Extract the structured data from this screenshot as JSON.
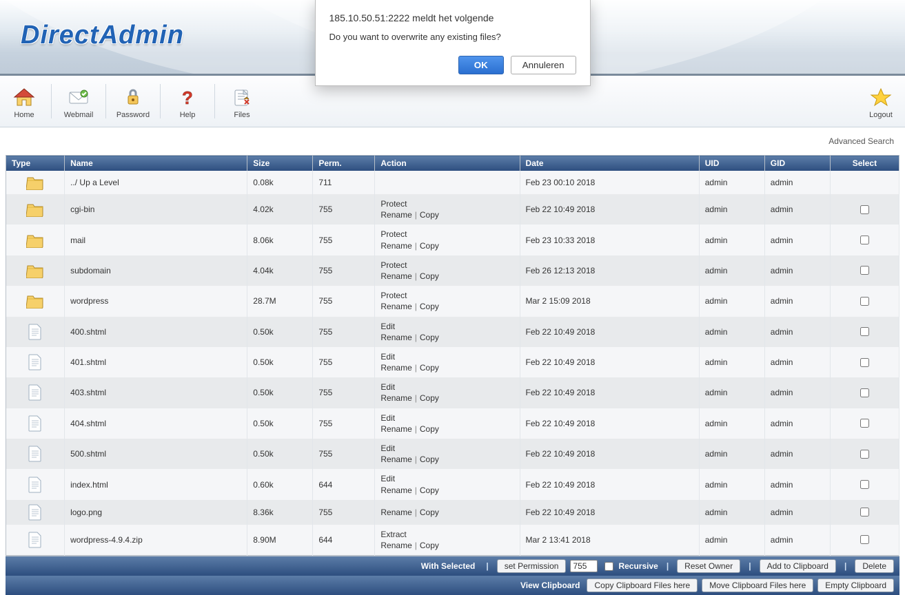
{
  "brand": "DirectAdmin",
  "modal": {
    "title": "185.10.50.51:2222 meldt het volgende",
    "message": "Do you want to overwrite any existing files?",
    "ok": "OK",
    "cancel": "Annuleren"
  },
  "toolbar": {
    "home": "Home",
    "webmail": "Webmail",
    "password": "Password",
    "help": "Help",
    "files": "Files",
    "logout": "Logout"
  },
  "advanced_search": "Advanced Search",
  "columns": {
    "type": "Type",
    "name": "Name",
    "size": "Size",
    "perm": "Perm.",
    "action": "Action",
    "date": "Date",
    "uid": "UID",
    "gid": "GID",
    "select": "Select"
  },
  "action_labels": {
    "protect": "Protect",
    "rename": "Rename",
    "copy": "Copy",
    "edit": "Edit",
    "extract": "Extract"
  },
  "rows": [
    {
      "icon": "folder",
      "name": "../ Up a Level",
      "size": "0.08k",
      "perm": "711",
      "top": null,
      "rc": false,
      "date": "Feb 23 00:10 2018",
      "uid": "admin",
      "gid": "admin",
      "selectable": false
    },
    {
      "icon": "folder",
      "name": "cgi-bin",
      "size": "4.02k",
      "perm": "755",
      "top": "protect",
      "rc": true,
      "date": "Feb 22 10:49 2018",
      "uid": "admin",
      "gid": "admin",
      "selectable": true
    },
    {
      "icon": "folder",
      "name": "mail",
      "size": "8.06k",
      "perm": "755",
      "top": "protect",
      "rc": true,
      "date": "Feb 23 10:33 2018",
      "uid": "admin",
      "gid": "admin",
      "selectable": true
    },
    {
      "icon": "folder",
      "name": "subdomain",
      "size": "4.04k",
      "perm": "755",
      "top": "protect",
      "rc": true,
      "date": "Feb 26 12:13 2018",
      "uid": "admin",
      "gid": "admin",
      "selectable": true
    },
    {
      "icon": "folder",
      "name": "wordpress",
      "size": "28.7M",
      "perm": "755",
      "top": "protect",
      "rc": true,
      "date": "Mar 2 15:09 2018",
      "uid": "admin",
      "gid": "admin",
      "selectable": true
    },
    {
      "icon": "file",
      "name": "400.shtml",
      "size": "0.50k",
      "perm": "755",
      "top": "edit",
      "rc": true,
      "date": "Feb 22 10:49 2018",
      "uid": "admin",
      "gid": "admin",
      "selectable": true
    },
    {
      "icon": "file",
      "name": "401.shtml",
      "size": "0.50k",
      "perm": "755",
      "top": "edit",
      "rc": true,
      "date": "Feb 22 10:49 2018",
      "uid": "admin",
      "gid": "admin",
      "selectable": true
    },
    {
      "icon": "file",
      "name": "403.shtml",
      "size": "0.50k",
      "perm": "755",
      "top": "edit",
      "rc": true,
      "date": "Feb 22 10:49 2018",
      "uid": "admin",
      "gid": "admin",
      "selectable": true
    },
    {
      "icon": "file",
      "name": "404.shtml",
      "size": "0.50k",
      "perm": "755",
      "top": "edit",
      "rc": true,
      "date": "Feb 22 10:49 2018",
      "uid": "admin",
      "gid": "admin",
      "selectable": true
    },
    {
      "icon": "file",
      "name": "500.shtml",
      "size": "0.50k",
      "perm": "755",
      "top": "edit",
      "rc": true,
      "date": "Feb 22 10:49 2018",
      "uid": "admin",
      "gid": "admin",
      "selectable": true
    },
    {
      "icon": "file",
      "name": "index.html",
      "size": "0.60k",
      "perm": "644",
      "top": "edit",
      "rc": true,
      "date": "Feb 22 10:49 2018",
      "uid": "admin",
      "gid": "admin",
      "selectable": true
    },
    {
      "icon": "file",
      "name": "logo.png",
      "size": "8.36k",
      "perm": "755",
      "top": null,
      "rc": true,
      "date": "Feb 22 10:49 2018",
      "uid": "admin",
      "gid": "admin",
      "selectable": true
    },
    {
      "icon": "file",
      "name": "wordpress-4.9.4.zip",
      "size": "8.90M",
      "perm": "644",
      "top": "extract",
      "rc": true,
      "date": "Mar 2 13:41 2018",
      "uid": "admin",
      "gid": "admin",
      "selectable": true
    }
  ],
  "footer1": {
    "with_selected": "With Selected",
    "set_permission": "set Permission",
    "perm_value": "755",
    "recursive": "Recursive",
    "reset_owner": "Reset Owner",
    "add_to_clipboard": "Add to Clipboard",
    "delete": "Delete"
  },
  "footer2": {
    "view_clipboard": "View Clipboard",
    "copy_clip_here": "Copy Clipboard Files here",
    "move_clip_here": "Move Clipboard Files here",
    "empty_clipboard": "Empty Clipboard"
  }
}
